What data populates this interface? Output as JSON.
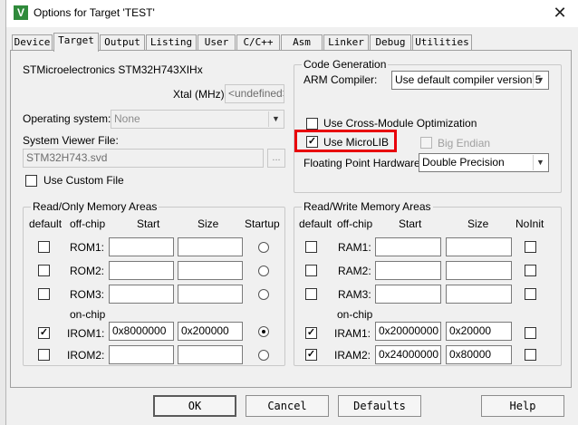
{
  "window": {
    "title": "Options for Target 'TEST'",
    "icon": "keil-v-icon"
  },
  "tabs": [
    {
      "label": "Device"
    },
    {
      "label": "Target"
    },
    {
      "label": "Output"
    },
    {
      "label": "Listing"
    },
    {
      "label": "User"
    },
    {
      "label": "C/C++"
    },
    {
      "label": "Asm"
    },
    {
      "label": "Linker"
    },
    {
      "label": "Debug"
    },
    {
      "label": "Utilities"
    }
  ],
  "active_tab": "Target",
  "device": {
    "name": "STMicroelectronics STM32H743XIHx",
    "xtal_label": "Xtal (MHz):",
    "xtal_value": "<undefined>",
    "os_label": "Operating system:",
    "os_value": "None",
    "svd_label": "System Viewer File:",
    "svd_value": "STM32H743.svd",
    "browse": "...",
    "custom_file_label": "Use Custom File",
    "custom_file_checked": false
  },
  "codegen": {
    "title": "Code Generation",
    "compiler_label": "ARM Compiler:",
    "compiler_value": "Use default compiler version 5",
    "cross_module_label": "Use Cross-Module Optimization",
    "cross_module_checked": false,
    "microlib_label": "Use MicroLIB",
    "microlib_checked": true,
    "big_endian_label": "Big Endian",
    "big_endian_checked": false,
    "fph_label": "Floating Point Hardware:",
    "fph_value": "Double Precision"
  },
  "ro": {
    "title": "Read/Only Memory Areas",
    "headers": {
      "default": "default",
      "offchip": "off-chip",
      "start": "Start",
      "size": "Size",
      "startup": "Startup"
    },
    "onchip_label": "on-chip",
    "rows": [
      {
        "name": "ROM1:",
        "default": false,
        "start": "",
        "size": "",
        "startup": false
      },
      {
        "name": "ROM2:",
        "default": false,
        "start": "",
        "size": "",
        "startup": false
      },
      {
        "name": "ROM3:",
        "default": false,
        "start": "",
        "size": "",
        "startup": false
      },
      {
        "name": "IROM1:",
        "default": true,
        "start": "0x8000000",
        "size": "0x200000",
        "startup": true
      },
      {
        "name": "IROM2:",
        "default": false,
        "start": "",
        "size": "",
        "startup": false
      }
    ]
  },
  "rw": {
    "title": "Read/Write Memory Areas",
    "headers": {
      "default": "default",
      "offchip": "off-chip",
      "start": "Start",
      "size": "Size",
      "noinit": "NoInit"
    },
    "onchip_label": "on-chip",
    "rows": [
      {
        "name": "RAM1:",
        "default": false,
        "start": "",
        "size": "",
        "noinit": false
      },
      {
        "name": "RAM2:",
        "default": false,
        "start": "",
        "size": "",
        "noinit": false
      },
      {
        "name": "RAM3:",
        "default": false,
        "start": "",
        "size": "",
        "noinit": false
      },
      {
        "name": "IRAM1:",
        "default": true,
        "start": "0x20000000",
        "size": "0x20000",
        "noinit": false
      },
      {
        "name": "IRAM2:",
        "default": true,
        "start": "0x24000000",
        "size": "0x80000",
        "noinit": false
      }
    ]
  },
  "buttons": {
    "ok": "OK",
    "cancel": "Cancel",
    "defaults": "Defaults",
    "help": "Help"
  },
  "icons": {
    "close": "close-icon",
    "dropdown": "chevron-down-icon"
  },
  "colors": {
    "highlight": "#e8000b",
    "titlebar": "#ffffff",
    "dialog": "#f0f0f0"
  }
}
